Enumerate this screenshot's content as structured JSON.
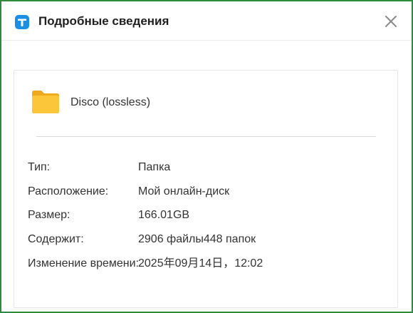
{
  "dialog": {
    "title": "Подробные сведения",
    "colors": {
      "border": "#2f8a3c",
      "app_icon": "#1a8fe3",
      "folder": "#f7b731"
    },
    "icons": {
      "app": "app-logo-icon",
      "close": "close-icon",
      "folder": "folder-icon"
    }
  },
  "item": {
    "name": "Disco (lossless)"
  },
  "details": [
    {
      "label": "Тип:",
      "value": "Папка"
    },
    {
      "label": "Расположение:",
      "value": "Мой онлайн-диск"
    },
    {
      "label": "Размер:",
      "value": "166.01GB"
    },
    {
      "label": "Содержит:",
      "value": "2906 файлы448 папок"
    },
    {
      "label": "Изменение времени:",
      "value": "2025年09月14日，12:02"
    }
  ]
}
